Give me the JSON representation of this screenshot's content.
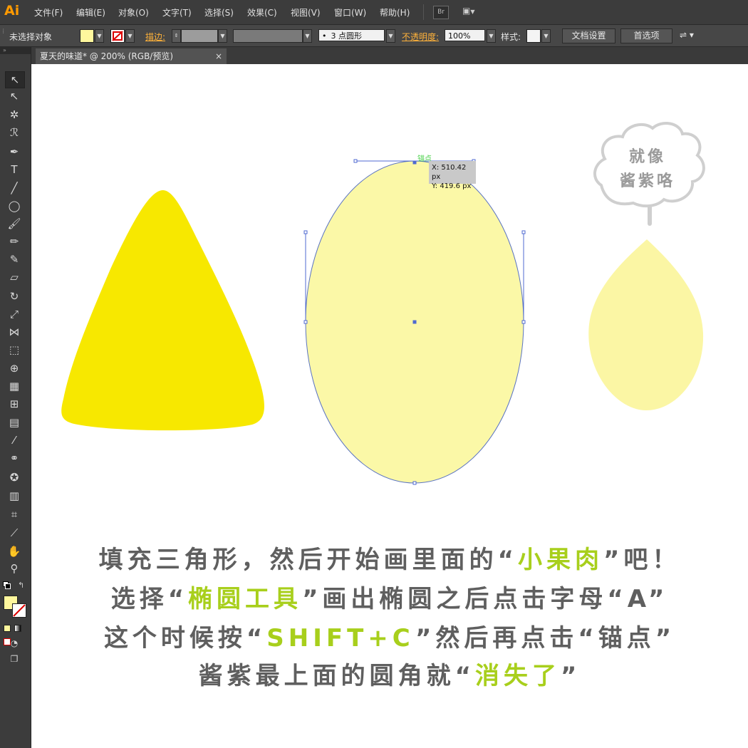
{
  "app": {
    "logo": "Ai"
  },
  "menu": {
    "items": [
      "文件(F)",
      "编辑(E)",
      "对象(O)",
      "文字(T)",
      "选择(S)",
      "效果(C)",
      "视图(V)",
      "窗口(W)",
      "帮助(H)"
    ],
    "bridge": "Br"
  },
  "control": {
    "selection_label": "未选择对象",
    "stroke_label": "描边:",
    "brush_value": "3 点圆形",
    "opacity_label": "不透明度:",
    "opacity_value": "100%",
    "style_label": "样式:",
    "doc_setup": "文档设置",
    "prefs": "首选项"
  },
  "document": {
    "tab_title": "夏天的味道* @ 200% (RGB/预览)",
    "close": "×"
  },
  "canvas": {
    "anchor_hint": "锚点",
    "coord_x": "X: 510.42 px",
    "coord_y": "Y: 419.6 px",
    "bubble_line1": "就像",
    "bubble_line2": "酱紫咯",
    "caption": [
      {
        "pre": "填充三角形，然后开始画里面的“",
        "hl": "小果肉",
        "post": "”吧！"
      },
      {
        "pre": "选择“",
        "hl": "椭圆工具",
        "post": "”画出椭圆之后点击字母“A”"
      },
      {
        "pre": "这个时候按“",
        "hl": "SHIFT+C",
        "post": "”然后再点击“锚点”"
      },
      {
        "pre": "酱紫最上面的圆角就“",
        "hl": "消失了",
        "post": "”"
      }
    ]
  },
  "colors": {
    "triangle": "#f7e800",
    "ellipse": "#fbf8a7",
    "petal": "#fbf6a4",
    "highlight": "#a8cf1c",
    "caption": "#5f5f5f",
    "fill_swatch": "#fff79d"
  }
}
